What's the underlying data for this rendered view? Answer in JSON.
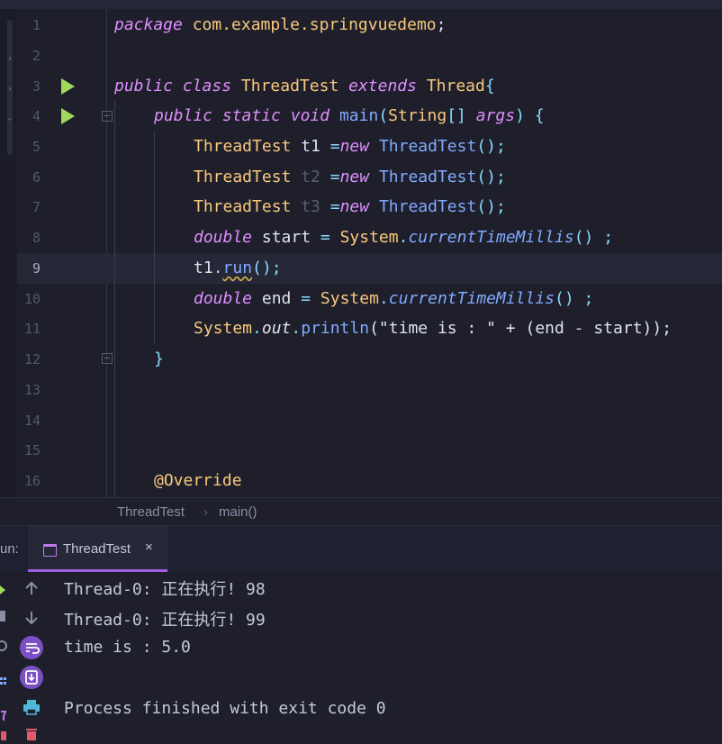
{
  "editor": {
    "line_numbers": [
      "1",
      "2",
      "3",
      "4",
      "5",
      "6",
      "7",
      "8",
      "9",
      "10",
      "11",
      "12",
      "13",
      "14",
      "15",
      "16"
    ],
    "current_line": "9",
    "code": {
      "l1_kw": "package",
      "l1_pkg": "com.example.springvuedemo",
      "l1_end": ";",
      "l3_public": "public",
      "l3_class": "class",
      "l3_name": "ThreadTest",
      "l3_extends": "extends",
      "l3_super": "Thread",
      "l3_brace": "{",
      "l4_public": "public",
      "l4_static": "static",
      "l4_void": "void",
      "l4_main": "main",
      "l4_paren": "(",
      "l4_type": "String",
      "l4_arr": "[] ",
      "l4_args": "args",
      "l4_end": ") {",
      "l5_type": "ThreadTest",
      "l5_var": "t1",
      "l5_eq": " =",
      "l5_new": "new",
      "l5_ctor": "ThreadTest",
      "l5_end": "();",
      "l6_type": "ThreadTest",
      "l6_var": "t2",
      "l6_eq": " =",
      "l6_new": "new",
      "l6_ctor": "ThreadTest",
      "l6_end": "();",
      "l7_type": "ThreadTest",
      "l7_var": "t3",
      "l7_eq": " =",
      "l7_new": "new",
      "l7_ctor": "ThreadTest",
      "l7_end": "();",
      "l8_type": "double",
      "l8_var": "start",
      "l8_eq": " = ",
      "l8_sys": "System",
      "l8_dot": ".",
      "l8_call": "currentTimeMillis",
      "l8_end": "() ;",
      "l9_var": "t1",
      "l9_dot": ".",
      "l9_run": "run",
      "l9_end": "();",
      "l10_type": "double",
      "l10_var": "end",
      "l10_eq": " = ",
      "l10_sys": "System",
      "l10_dot": ".",
      "l10_call": "currentTimeMillis",
      "l10_end": "() ;",
      "l11_sys": "System",
      "l11_dot": ".",
      "l11_out": "out",
      "l11_dot2": ".",
      "l11_println": "println",
      "l11_rest": "(\"time is : \" + (end - start));",
      "l12_brace": "}",
      "l16_ann": "@Override"
    }
  },
  "breadcrumb": {
    "class": "ThreadTest",
    "sep": "›",
    "method": "main()"
  },
  "run_panel": {
    "label": "un:",
    "tab_label": "ThreadTest",
    "tab_close": "×"
  },
  "console": {
    "lines": [
      "Thread-0: 正在执行! 98",
      "Thread-0: 正在执行! 99",
      "time is : 5.0",
      "",
      "Process finished with exit code 0"
    ]
  },
  "colors": {
    "background": "#1e1f2b",
    "keyword": "#e08eff",
    "class": "#f9c97c",
    "method": "#82aaff",
    "run_green": "#9fd95b",
    "tab_accent": "#9e5fe0"
  }
}
